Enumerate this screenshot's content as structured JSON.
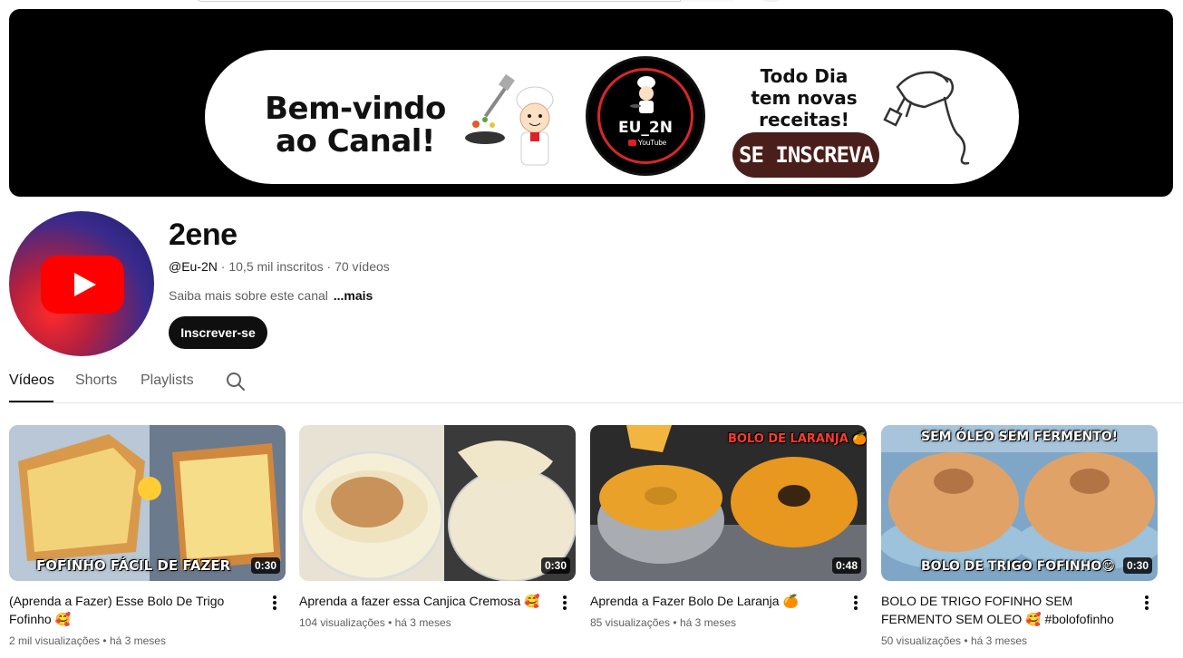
{
  "banner": {
    "welcome_line1": "Bem-vindo",
    "welcome_line2": "ao Canal!",
    "logo_text": "EU_2N",
    "logo_sub": "YouTube",
    "todo_dia_line1": "Todo Dia",
    "todo_dia_line2": "tem novas",
    "todo_dia_line3": "receitas!",
    "subscribe_cta": "SE INSCREVA"
  },
  "channel": {
    "name": "2ene",
    "handle": "@Eu-2N",
    "subscribers": "10,5 mil inscritos",
    "video_count": "70 vídeos",
    "separator": "·",
    "about": "Saiba mais sobre este canal",
    "about_more": "...mais",
    "subscribe_label": "Inscrever-se"
  },
  "tabs": [
    {
      "label": "Vídeos",
      "active": true
    },
    {
      "label": "Shorts",
      "active": false
    },
    {
      "label": "Playlists",
      "active": false
    }
  ],
  "videos": [
    {
      "title": "(Aprenda a Fazer) Esse Bolo De Trigo Fofinho 🥰",
      "views": "2 mil visualizações",
      "age": "há 3 meses",
      "duration": "0:30",
      "thumb_caption": "FOFINHO FÁCIL DE FAZER"
    },
    {
      "title": "Aprenda a fazer essa Canjica Cremosa 🥰",
      "views": "104 visualizações",
      "age": "há 3 meses",
      "duration": "0:30",
      "thumb_caption": ""
    },
    {
      "title": "Aprenda a Fazer Bolo De Laranja 🍊",
      "views": "85 visualizações",
      "age": "há 3 meses",
      "duration": "0:48",
      "thumb_caption": "BOLO DE LARANJA 🍊"
    },
    {
      "title": "BOLO DE TRIGO FOFINHO SEM FERMENTO SEM OLEO 🥰 #bolofofinho",
      "views": "50 visualizações",
      "age": "há 3 meses",
      "duration": "0:30",
      "thumb_caption": "SEM ÓLEO SEM FERMENTO!",
      "thumb_caption_bottom": "BOLO DE TRIGO FOFINHO😋"
    }
  ],
  "meta_separator": "•",
  "colors": {
    "brand_red": "#ff0000",
    "text_primary": "#0f0f0f",
    "text_secondary": "#606060",
    "banner_bg": "#000000",
    "cta_brown": "#4a1e1a"
  }
}
